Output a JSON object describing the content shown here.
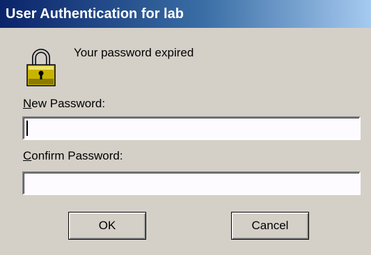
{
  "window": {
    "title": "User Authentication for lab"
  },
  "icon": "padlock-icon",
  "message": "Your password expired",
  "fields": {
    "new_password": {
      "label_accel": "N",
      "label_rest": "ew Password:",
      "value": ""
    },
    "confirm_password": {
      "label_accel": "C",
      "label_rest": "onfirm Password:",
      "value": ""
    }
  },
  "buttons": {
    "ok": "OK",
    "cancel": "Cancel"
  },
  "colors": {
    "dialog_bg": "#d4d0c8",
    "title_gradient_start": "#0a246a",
    "title_gradient_end": "#a6caf0",
    "lock_gold": "#c8b400"
  }
}
